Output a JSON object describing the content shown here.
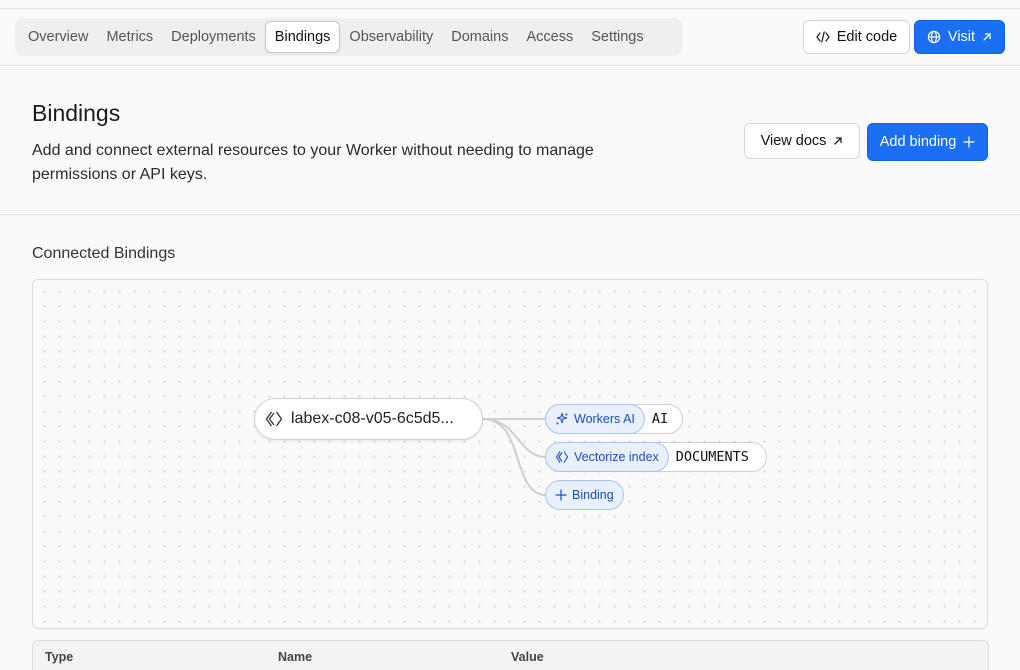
{
  "tabs": [
    {
      "label": "Overview"
    },
    {
      "label": "Metrics"
    },
    {
      "label": "Deployments"
    },
    {
      "label": "Bindings",
      "active": true
    },
    {
      "label": "Observability"
    },
    {
      "label": "Domains"
    },
    {
      "label": "Access"
    },
    {
      "label": "Settings"
    }
  ],
  "header_actions": {
    "edit_code": "Edit code",
    "visit": "Visit"
  },
  "page": {
    "title": "Bindings",
    "description": "Add and connect external resources to your Worker without needing to manage permissions or API keys.",
    "view_docs": "View docs",
    "add_binding": "Add binding"
  },
  "connected": {
    "title": "Connected Bindings",
    "worker_name": "labex-c08-v05-6c5d5...",
    "bindings": [
      {
        "type_label": "Workers AI",
        "name": "AI",
        "icon": "sparkle-icon"
      },
      {
        "type_label": "Vectorize index",
        "name": "DOCUMENTS",
        "icon": "diamond-icon"
      }
    ],
    "add_label": "Binding"
  },
  "table": {
    "columns": [
      "Type",
      "Name",
      "Value"
    ]
  },
  "colors": {
    "accent": "#1a6ff5",
    "pill_bg": "#e8f0fd",
    "pill_text": "#1a4fb8"
  }
}
